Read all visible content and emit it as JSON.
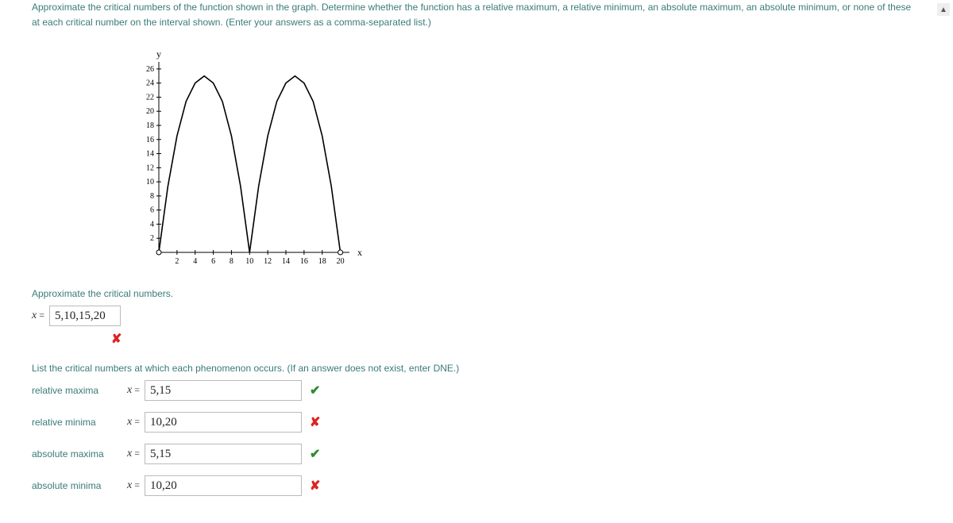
{
  "question": "Approximate the critical numbers of the function shown in the graph. Determine whether the function has a relative maximum, a relative minimum, an absolute maximum, an absolute minimum, or none of these at each critical number on the interval shown. (Enter your answers as a comma-separated list.)",
  "prompt1": "Approximate the critical numbers.",
  "prompt2": "List the critical numbers at which each phenomenon occurs. (If an answer does not exist, enter DNE.)",
  "x_equals": "x",
  "eq": " = ",
  "answers": {
    "critical": {
      "value": "5,10,15,20",
      "status": "incorrect"
    },
    "relmax": {
      "label": "relative maxima",
      "value": "5,15",
      "status": "correct"
    },
    "relmin": {
      "label": "relative minima",
      "value": "10,20",
      "status": "incorrect"
    },
    "absmax": {
      "label": "absolute maxima",
      "value": "5,15",
      "status": "correct"
    },
    "absmin": {
      "label": "absolute minima",
      "value": "10,20",
      "status": "incorrect"
    }
  },
  "chart_data": {
    "type": "line",
    "x": [
      0,
      1,
      2,
      3,
      4,
      5,
      6,
      7,
      8,
      9,
      10,
      11,
      12,
      13,
      14,
      15,
      16,
      17,
      18,
      19,
      20
    ],
    "y": [
      0,
      9.4,
      16.5,
      21.4,
      24,
      25,
      24,
      21.4,
      16.5,
      9.4,
      0,
      9.4,
      16.5,
      21.4,
      24,
      25,
      24,
      21.4,
      16.5,
      9.4,
      0
    ],
    "xlabel": "x",
    "ylabel": "y",
    "xticks": [
      2,
      4,
      6,
      8,
      10,
      12,
      14,
      16,
      18,
      20
    ],
    "yticks": [
      2,
      4,
      6,
      8,
      10,
      12,
      14,
      16,
      18,
      20,
      22,
      24,
      26
    ],
    "xlim": [
      0,
      21
    ],
    "ylim": [
      0,
      27
    ]
  }
}
